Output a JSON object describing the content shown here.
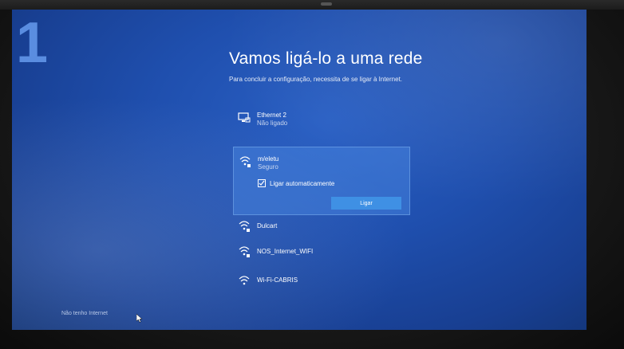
{
  "step_marker": "1",
  "setup": {
    "title": "Vamos ligá-lo a uma rede",
    "subtitle": "Para concluir a configuração, necessita de se ligar à Internet."
  },
  "networks": {
    "ethernet": {
      "name": "Ethernet 2",
      "status": "Não ligado",
      "icon": "ethernet-monitor-icon"
    },
    "selected": {
      "name": "m/eletu",
      "status": "Seguro",
      "icon": "wifi-secured-icon",
      "auto_connect_label": "Ligar automaticamente",
      "auto_connect_checked": true,
      "connect_label": "Ligar"
    },
    "others": [
      {
        "name": "Dulcart",
        "icon": "wifi-secured-icon"
      },
      {
        "name": "NOS_Internet_WIFI",
        "icon": "wifi-secured-icon"
      },
      {
        "name": "Wi-Fi-CABRIS",
        "icon": "wifi-icon"
      }
    ]
  },
  "footer": {
    "no_internet_link": "Não tenho Internet"
  },
  "colors": {
    "screen_blue": "#1f4fae",
    "selected_bg": "#4682dc",
    "button_blue": "#3f90e4",
    "step_marker": "#5a8de0"
  }
}
